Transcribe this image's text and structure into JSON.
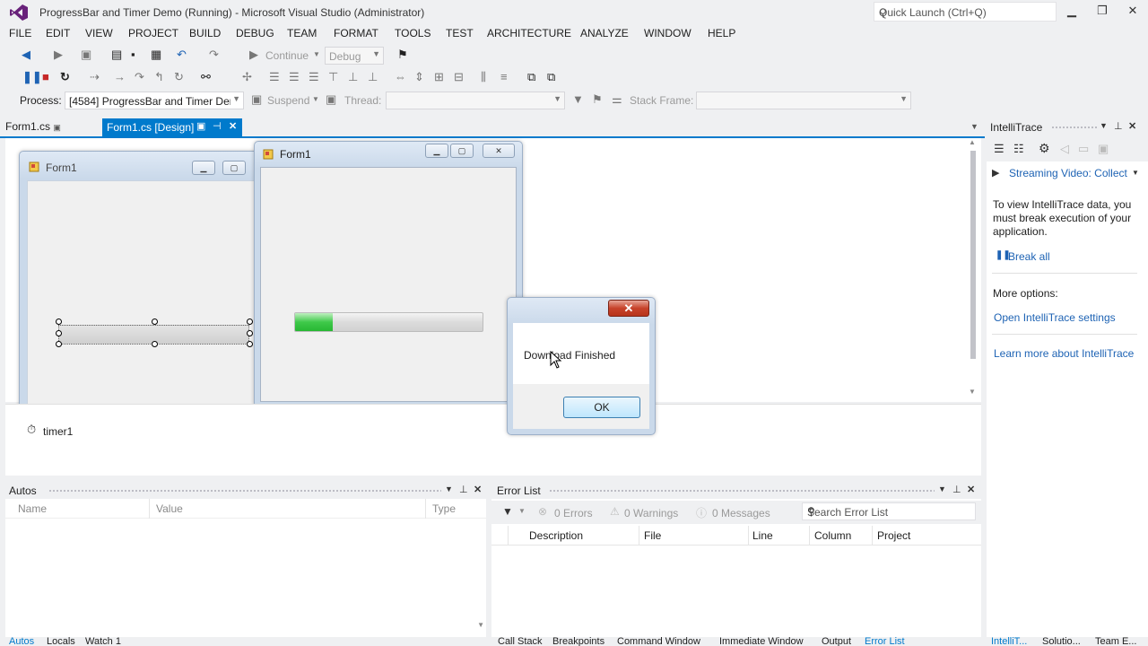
{
  "window": {
    "title": "ProgressBar and Timer Demo (Running) - Microsoft Visual Studio (Administrator)",
    "quick_launch_placeholder": "Quick Launch (Ctrl+Q)"
  },
  "menu": [
    "FILE",
    "EDIT",
    "VIEW",
    "PROJECT",
    "BUILD",
    "DEBUG",
    "TEAM",
    "FORMAT",
    "TOOLS",
    "TEST",
    "ARCHITECTURE",
    "ANALYZE",
    "WINDOW",
    "HELP"
  ],
  "toolbar": {
    "continue_label": "Continue",
    "config_value": "Debug",
    "process_label": "Process:",
    "process_value": "[4584] ProgressBar and Timer Dem",
    "suspend_label": "Suspend",
    "thread_label": "Thread:",
    "stack_frame_label": "Stack Frame:"
  },
  "tabs": {
    "inactive": "Form1.cs",
    "active": "Form1.cs [Design]"
  },
  "designer": {
    "form_caption": "Form1",
    "running_form_caption": "Form1",
    "component_tray_item": "timer1",
    "progress_fraction": 0.2
  },
  "messagebox": {
    "text": "Download Finished",
    "ok_label": "OK",
    "close_glyph": "✕"
  },
  "autos": {
    "title": "Autos",
    "columns": [
      "Name",
      "Value",
      "Type"
    ]
  },
  "error_list": {
    "title": "Error List",
    "errors": "0 Errors",
    "warnings": "0 Warnings",
    "messages": "0 Messages",
    "search_placeholder": "Search Error List",
    "columns": [
      "Description",
      "File",
      "Line",
      "Column",
      "Project"
    ]
  },
  "bottom_tabs_left": [
    "Autos",
    "Locals",
    "Watch 1"
  ],
  "bottom_tabs_right": [
    "Call Stack",
    "Breakpoints",
    "Command Window",
    "Immediate Window",
    "Output",
    "Error List"
  ],
  "bottom_tabs_far": [
    "IntelliT...",
    "Solutio...",
    "Team E..."
  ],
  "intellitrace": {
    "title": "IntelliTrace",
    "streaming": "Streaming Video: Collect",
    "info": "To view IntelliTrace data, you must break execution of your application.",
    "break_all": "Break all",
    "more_options": "More options:",
    "open_settings": "Open IntelliTrace settings",
    "learn_more": "Learn more about IntelliTrace"
  },
  "colors": {
    "accent": "#007acc",
    "link": "#1e63b4",
    "progress_green": "#3fc94a"
  }
}
